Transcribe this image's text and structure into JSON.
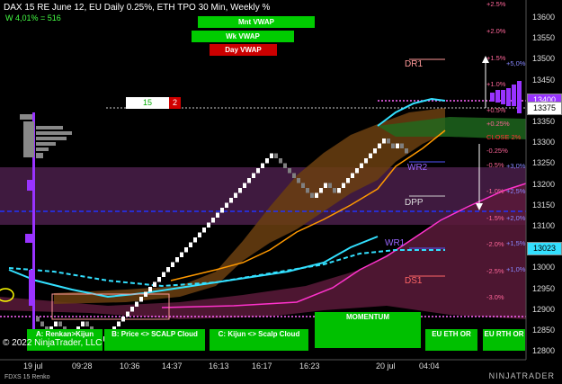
{
  "header": {
    "title": "DAX 15  RE June 12, EU Daily 0.25%, ETH TPO 30 Min, Weekly %",
    "subtitle": "W 4,01% = 516"
  },
  "vwap_buttons": [
    {
      "label": "Mnt VWAP",
      "color": "#00cc00"
    },
    {
      "label": "Wk VWAP",
      "color": "#00cc00"
    },
    {
      "label": "Day VWAP",
      "color": "#cc0000"
    }
  ],
  "counter": {
    "left_value": "15",
    "right_value": "2"
  },
  "levels": {
    "dr1": "DR1",
    "wr2": "WR2",
    "dpp": "DPP",
    "wr1": "WR1",
    "ds1": "DS1",
    "close": "CLOSE  2%"
  },
  "percent_labels": {
    "p25": "+2.5%",
    "p20": "+2.0%",
    "p15": "+1.5%",
    "p10": "+1.0%",
    "p05": "+0.5%",
    "p025": "+0.25%",
    "m025": "-0.25%",
    "m05": "-0.5%",
    "m10": "-1.0%",
    "m15": "-1.5%",
    "m20": "-2.0%",
    "m25": "-2.5%",
    "m30": "-3.0%",
    "w50": "+5,0%",
    "w30": "+3,0%",
    "w25": "+2,5%",
    "w20": "+2,0%",
    "w15": "+1,5%",
    "w10": "+1,0%"
  },
  "price_axis": [
    "13600",
    "13550",
    "13500",
    "13450",
    "13400",
    "13350",
    "13300",
    "13250",
    "13200",
    "13150",
    "13100",
    "13050",
    "13000",
    "12950",
    "12900",
    "12850",
    "12800"
  ],
  "price_tags": {
    "upper": "13375",
    "lower": "13023",
    "top_hidden": "13400"
  },
  "time_axis": [
    "19 jul",
    "09:28",
    "10:36",
    "14:37",
    "16:13",
    "16:17",
    "16:23",
    "20 jul",
    "04:04"
  ],
  "bottom_buttons": [
    {
      "label": "A: Renkan>Kijun",
      "color": "#00c000"
    },
    {
      "label": "B: Price <> SCALP Cloud",
      "color": "#00c000"
    },
    {
      "label": "C: Kijun <> Scalp Cloud",
      "color": "#00c000"
    },
    {
      "label": "MOMENTUM",
      "color": "#00c000"
    },
    {
      "label": "EU ETH OR",
      "color": "#00c000"
    },
    {
      "label": "EU RTH OR",
      "color": "#00c000"
    }
  ],
  "copyright": "© 2022 NinjaTrader, LLC",
  "footer": "FDXS 15 Renko",
  "brand": "NINJATRADER",
  "colors": {
    "up": "#ffffff",
    "down": "#808080",
    "cyan": "#33e0ff",
    "orange": "#ff9900",
    "magenta": "#ff33cc",
    "purple": "#9933ff"
  }
}
